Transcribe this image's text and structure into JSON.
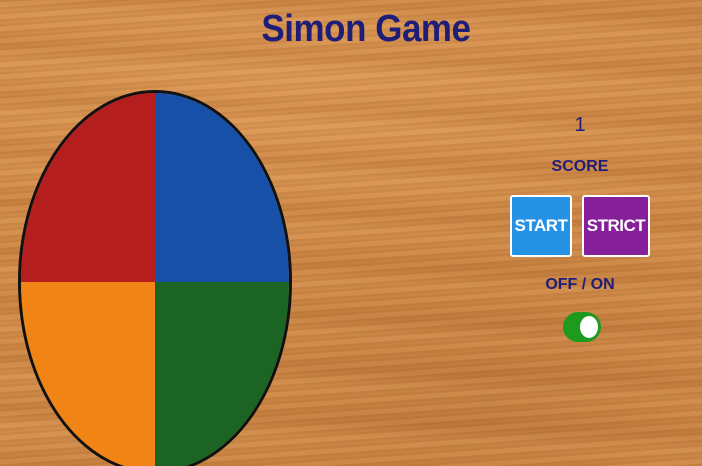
{
  "title": "Simon Game",
  "board": {
    "pads": [
      {
        "position": "top-left",
        "color": "#b51e1f"
      },
      {
        "position": "top-right",
        "color": "#1650a8"
      },
      {
        "position": "bottom-left",
        "color": "#f08516"
      },
      {
        "position": "bottom-right",
        "color": "#1c6424"
      }
    ]
  },
  "count_value": "1",
  "score_label": "SCORE",
  "buttons": {
    "start_label": "START",
    "start_color": "#2592e6",
    "strict_label": "STRICT",
    "strict_color": "#85209a"
  },
  "power": {
    "label": "OFF / ON",
    "state": "on",
    "track_color": "#1e9a1e"
  }
}
